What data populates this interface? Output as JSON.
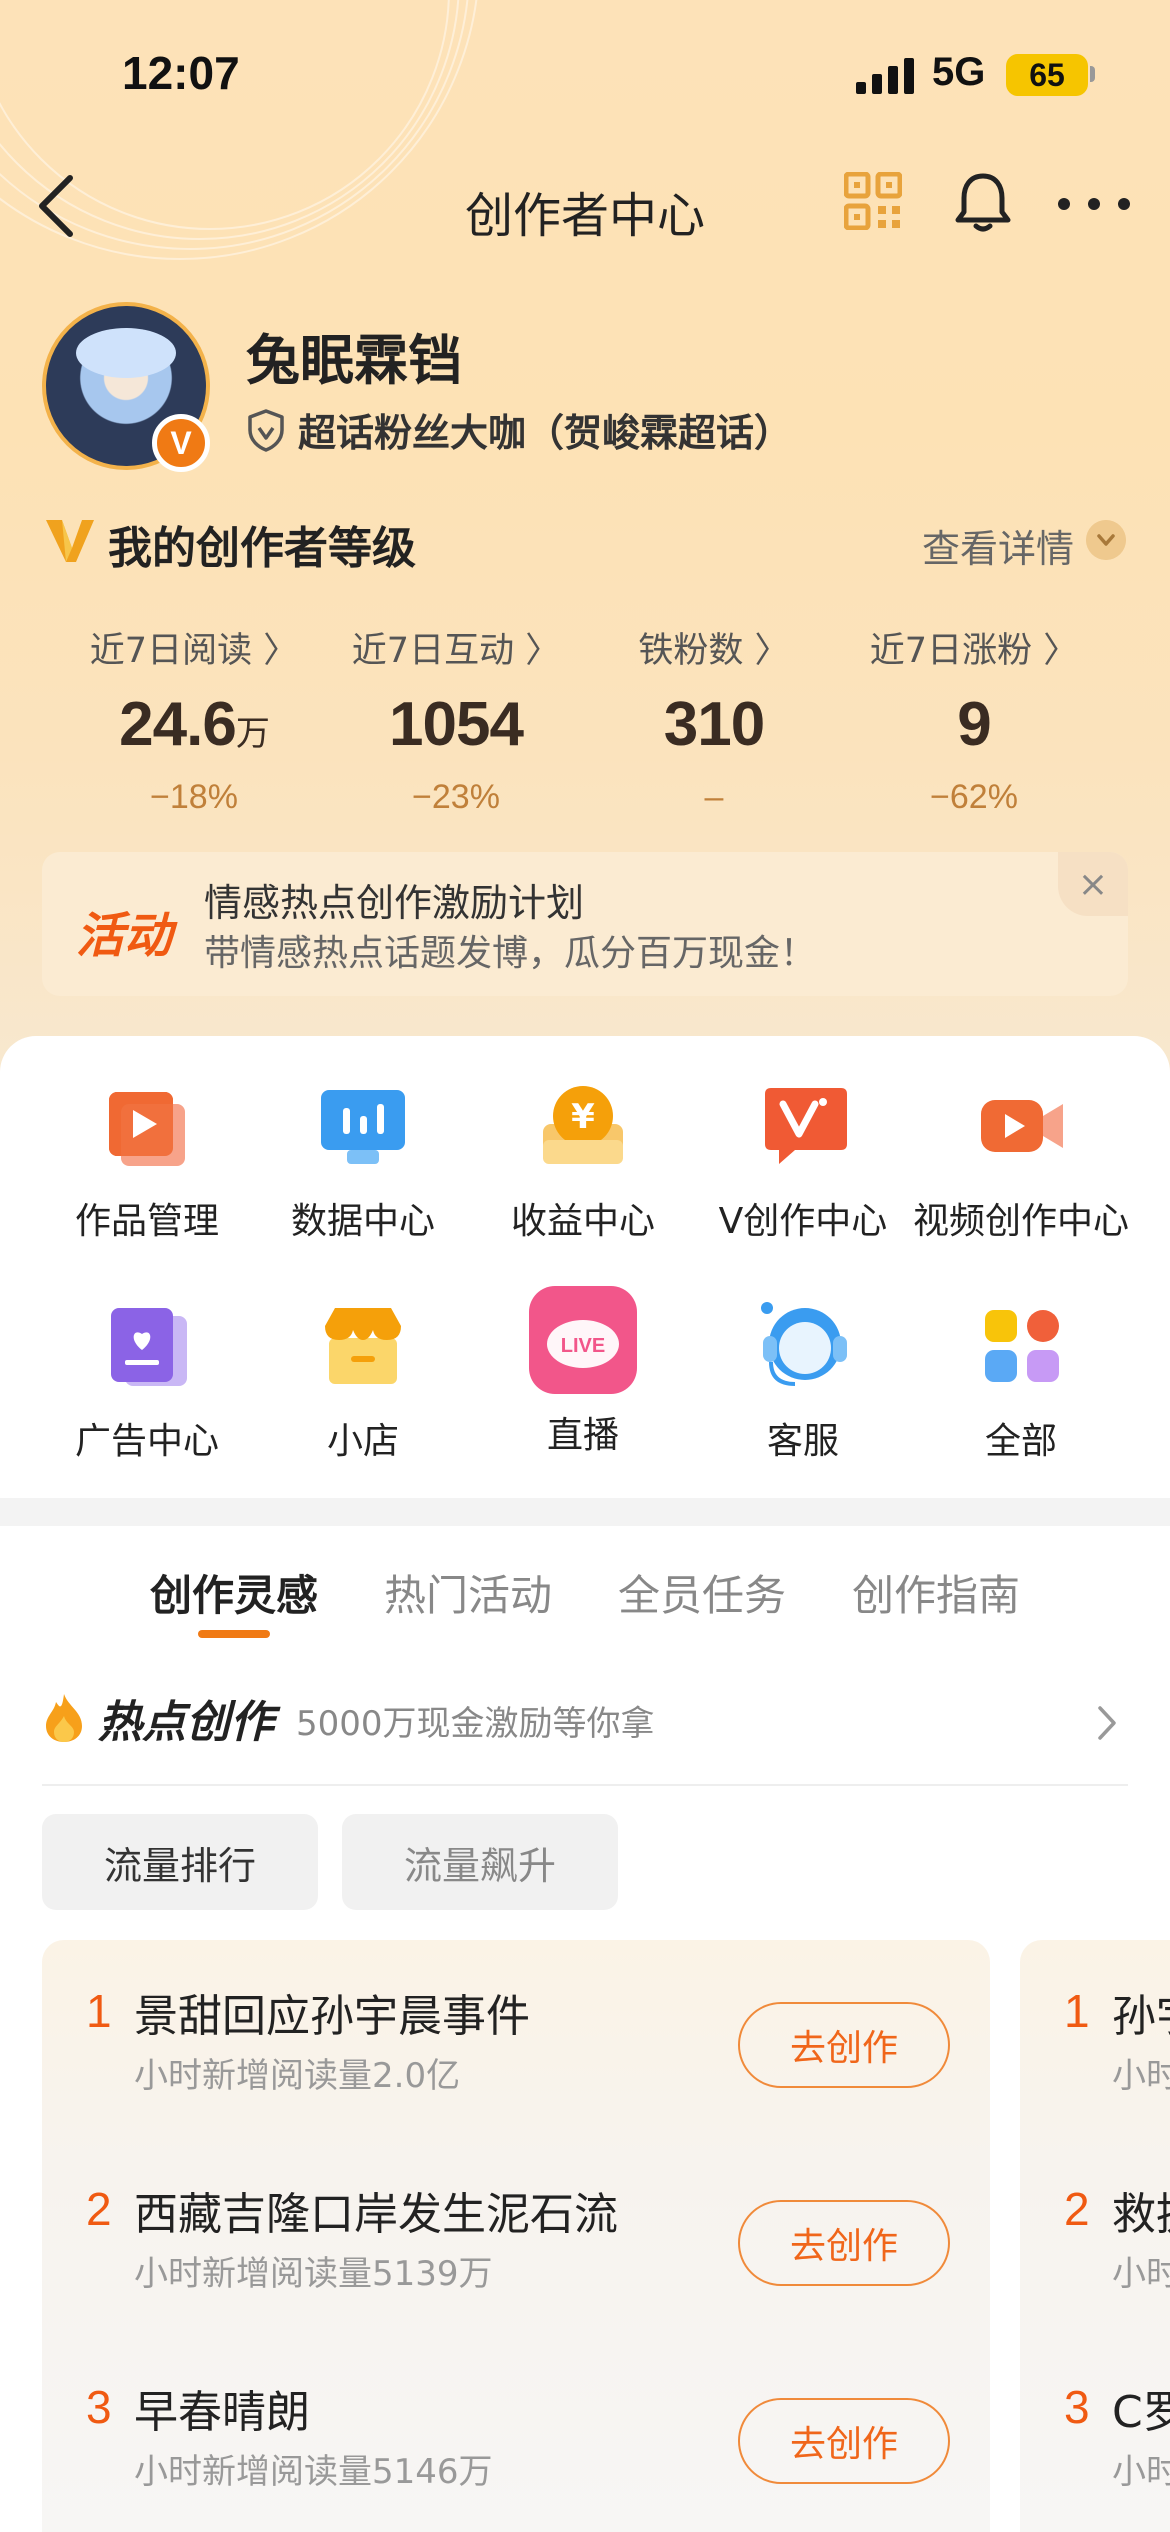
{
  "status_bar": {
    "time": "12:07",
    "network": "5G",
    "battery": "65"
  },
  "nav": {
    "title": "创作者中心"
  },
  "profile": {
    "username": "兔眠霖铛",
    "badge_text": "超话粉丝大咖（贺峻霖超话）",
    "verified_mark": "V"
  },
  "level": {
    "title": "我的创作者等级",
    "details": "查看详情"
  },
  "stats": [
    {
      "label": "近7日阅读 〉",
      "value": "24.6",
      "unit": "万",
      "change": "−18%"
    },
    {
      "label": "近7日互动 〉",
      "value": "1054",
      "unit": "",
      "change": "−23%"
    },
    {
      "label": "铁粉数 〉",
      "value": "310",
      "unit": "",
      "change": "–"
    },
    {
      "label": "近7日涨粉 〉",
      "value": "9",
      "unit": "",
      "change": "−62%"
    }
  ],
  "promo": {
    "tag": "活动",
    "title": "情感热点创作激励计划",
    "subtitle": "带情感热点话题发博，瓜分百万现金！",
    "close": "×"
  },
  "tools": [
    {
      "label": "作品管理",
      "icon": "works-icon"
    },
    {
      "label": "数据中心",
      "icon": "data-icon"
    },
    {
      "label": "收益中心",
      "icon": "income-icon"
    },
    {
      "label": "V创作中心",
      "icon": "v-create-icon"
    },
    {
      "label": "视频创作中心",
      "icon": "video-create-icon"
    },
    {
      "label": "广告中心",
      "icon": "ad-icon"
    },
    {
      "label": "小店",
      "icon": "shop-icon"
    },
    {
      "label": "直播",
      "icon": "live-icon"
    },
    {
      "label": "客服",
      "icon": "service-icon"
    },
    {
      "label": "全部",
      "icon": "all-icon"
    }
  ],
  "live_icon_text": "LIVE",
  "tabs": [
    "创作灵感",
    "热门活动",
    "全员任务",
    "创作指南"
  ],
  "hot": {
    "title": "热点创作",
    "subtitle": "5000万现金激励等你拿"
  },
  "chips": [
    "流量排行",
    "流量飙升"
  ],
  "ranking": [
    {
      "rank": "1",
      "title": "景甜回应孙宇晨事件",
      "sub": "小时新增阅读量2.0亿",
      "button": "去创作"
    },
    {
      "rank": "2",
      "title": "西藏吉隆口岸发生泥石流",
      "sub": "小时新增阅读量5139万",
      "button": "去创作"
    },
    {
      "rank": "3",
      "title": "早春晴朗",
      "sub": "小时新增阅读量5146万",
      "button": "去创作"
    }
  ],
  "ranking2": [
    {
      "rank": "1",
      "title": "孙宇",
      "sub": "小时"
    },
    {
      "rank": "2",
      "title": "救援",
      "sub": "小时"
    },
    {
      "rank": "3",
      "title": "C罗",
      "sub": "小时"
    }
  ],
  "colors": {
    "accent": "#f07a14",
    "rank_number": "#f05a12",
    "header_bg": "#fde2b8"
  }
}
